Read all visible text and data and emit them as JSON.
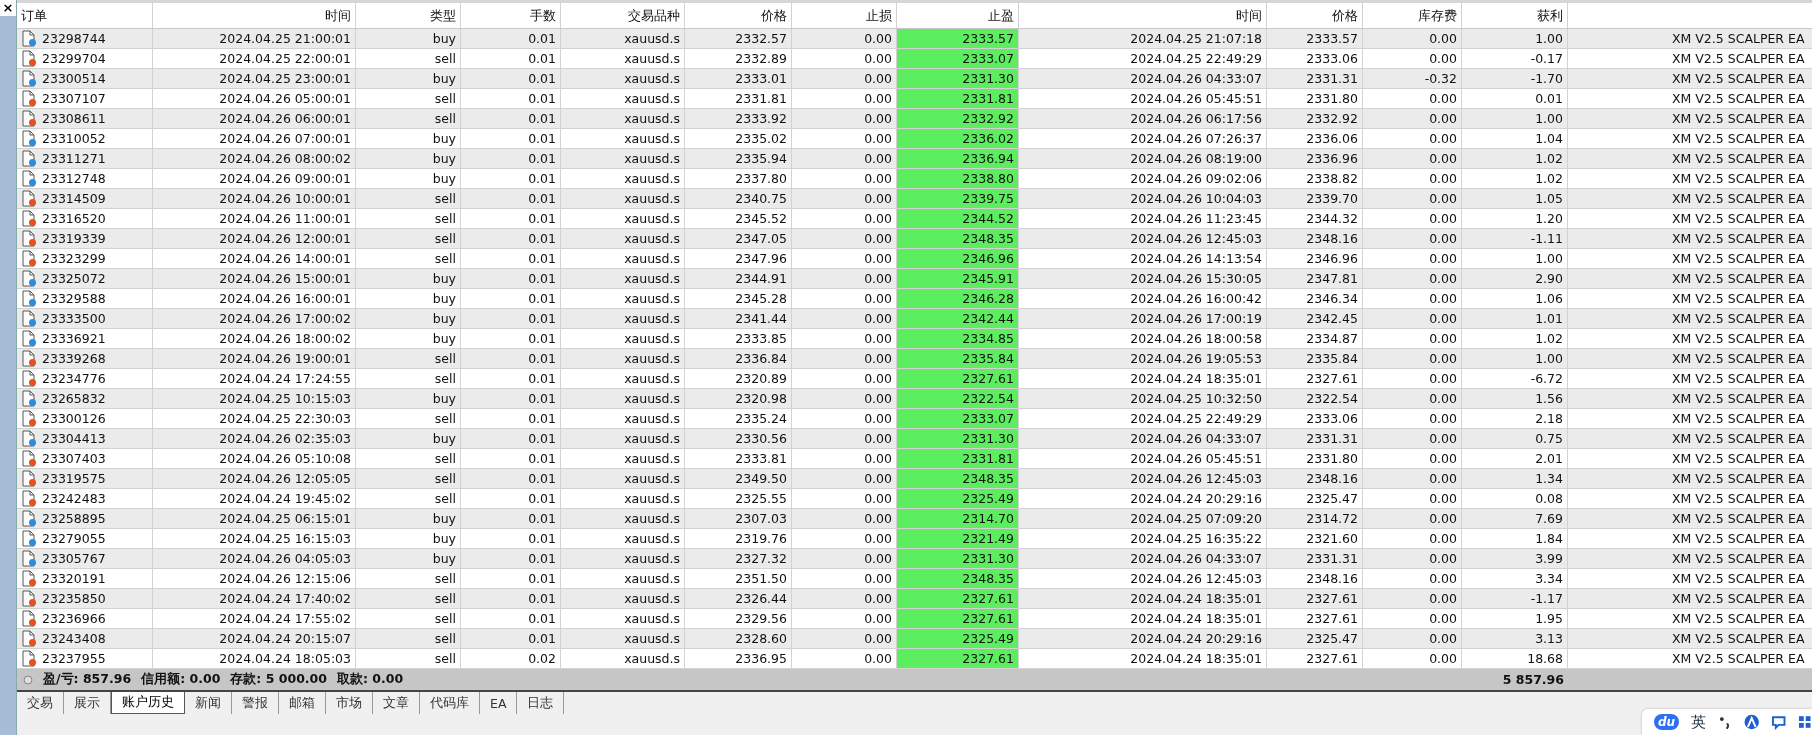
{
  "side_panel": {
    "close_glyph": "×"
  },
  "table": {
    "columns": [
      "订单",
      "时间",
      "类型",
      "手数",
      "交易品种",
      "价格",
      "止损",
      "止盈",
      "时间",
      "价格",
      "库存费",
      "获利"
    ],
    "rows": [
      {
        "color": "#2b8de0",
        "cells": [
          "23298744",
          "2024.04.25 21:00:01",
          "buy",
          "0.01",
          "xauusd.s",
          "2332.57",
          "0.00",
          "2333.57",
          "2024.04.25 21:07:18",
          "2333.57",
          "0.00",
          "1.00",
          "XM V2.5 SCALPER EA"
        ]
      },
      {
        "color": "#e8501e",
        "cells": [
          "23299704",
          "2024.04.25 22:00:01",
          "sell",
          "0.01",
          "xauusd.s",
          "2332.89",
          "0.00",
          "2333.07",
          "2024.04.25 22:49:29",
          "2333.06",
          "0.00",
          "-0.17",
          "XM V2.5 SCALPER EA"
        ]
      },
      {
        "color": "#2b8de0",
        "cells": [
          "23300514",
          "2024.04.25 23:00:01",
          "buy",
          "0.01",
          "xauusd.s",
          "2333.01",
          "0.00",
          "2331.30",
          "2024.04.26 04:33:07",
          "2331.31",
          "-0.32",
          "-1.70",
          "XM V2.5 SCALPER EA"
        ]
      },
      {
        "color": "#e8501e",
        "cells": [
          "23307107",
          "2024.04.26 05:00:01",
          "sell",
          "0.01",
          "xauusd.s",
          "2331.81",
          "0.00",
          "2331.81",
          "2024.04.26 05:45:51",
          "2331.80",
          "0.00",
          "0.01",
          "XM V2.5 SCALPER EA"
        ]
      },
      {
        "color": "#e8501e",
        "cells": [
          "23308611",
          "2024.04.26 06:00:01",
          "sell",
          "0.01",
          "xauusd.s",
          "2333.92",
          "0.00",
          "2332.92",
          "2024.04.26 06:17:56",
          "2332.92",
          "0.00",
          "1.00",
          "XM V2.5 SCALPER EA"
        ]
      },
      {
        "color": "#2b8de0",
        "cells": [
          "23310052",
          "2024.04.26 07:00:01",
          "buy",
          "0.01",
          "xauusd.s",
          "2335.02",
          "0.00",
          "2336.02",
          "2024.04.26 07:26:37",
          "2336.06",
          "0.00",
          "1.04",
          "XM V2.5 SCALPER EA"
        ]
      },
      {
        "color": "#2b8de0",
        "cells": [
          "23311271",
          "2024.04.26 08:00:02",
          "buy",
          "0.01",
          "xauusd.s",
          "2335.94",
          "0.00",
          "2336.94",
          "2024.04.26 08:19:00",
          "2336.96",
          "0.00",
          "1.02",
          "XM V2.5 SCALPER EA"
        ]
      },
      {
        "color": "#2b8de0",
        "cells": [
          "23312748",
          "2024.04.26 09:00:01",
          "buy",
          "0.01",
          "xauusd.s",
          "2337.80",
          "0.00",
          "2338.80",
          "2024.04.26 09:02:06",
          "2338.82",
          "0.00",
          "1.02",
          "XM V2.5 SCALPER EA"
        ]
      },
      {
        "color": "#e8501e",
        "cells": [
          "23314509",
          "2024.04.26 10:00:01",
          "sell",
          "0.01",
          "xauusd.s",
          "2340.75",
          "0.00",
          "2339.75",
          "2024.04.26 10:04:03",
          "2339.70",
          "0.00",
          "1.05",
          "XM V2.5 SCALPER EA"
        ]
      },
      {
        "color": "#e8501e",
        "cells": [
          "23316520",
          "2024.04.26 11:00:01",
          "sell",
          "0.01",
          "xauusd.s",
          "2345.52",
          "0.00",
          "2344.52",
          "2024.04.26 11:23:45",
          "2344.32",
          "0.00",
          "1.20",
          "XM V2.5 SCALPER EA"
        ]
      },
      {
        "color": "#e8501e",
        "cells": [
          "23319339",
          "2024.04.26 12:00:01",
          "sell",
          "0.01",
          "xauusd.s",
          "2347.05",
          "0.00",
          "2348.35",
          "2024.04.26 12:45:03",
          "2348.16",
          "0.00",
          "-1.11",
          "XM V2.5 SCALPER EA"
        ]
      },
      {
        "color": "#e8501e",
        "cells": [
          "23323299",
          "2024.04.26 14:00:01",
          "sell",
          "0.01",
          "xauusd.s",
          "2347.96",
          "0.00",
          "2346.96",
          "2024.04.26 14:13:54",
          "2346.96",
          "0.00",
          "1.00",
          "XM V2.5 SCALPER EA"
        ]
      },
      {
        "color": "#2b8de0",
        "cells": [
          "23325072",
          "2024.04.26 15:00:01",
          "buy",
          "0.01",
          "xauusd.s",
          "2344.91",
          "0.00",
          "2345.91",
          "2024.04.26 15:30:05",
          "2347.81",
          "0.00",
          "2.90",
          "XM V2.5 SCALPER EA"
        ]
      },
      {
        "color": "#2b8de0",
        "cells": [
          "23329588",
          "2024.04.26 16:00:01",
          "buy",
          "0.01",
          "xauusd.s",
          "2345.28",
          "0.00",
          "2346.28",
          "2024.04.26 16:00:42",
          "2346.34",
          "0.00",
          "1.06",
          "XM V2.5 SCALPER EA"
        ]
      },
      {
        "color": "#2b8de0",
        "cells": [
          "23333500",
          "2024.04.26 17:00:02",
          "buy",
          "0.01",
          "xauusd.s",
          "2341.44",
          "0.00",
          "2342.44",
          "2024.04.26 17:00:19",
          "2342.45",
          "0.00",
          "1.01",
          "XM V2.5 SCALPER EA"
        ]
      },
      {
        "color": "#2b8de0",
        "cells": [
          "23336921",
          "2024.04.26 18:00:02",
          "buy",
          "0.01",
          "xauusd.s",
          "2333.85",
          "0.00",
          "2334.85",
          "2024.04.26 18:00:58",
          "2334.87",
          "0.00",
          "1.02",
          "XM V2.5 SCALPER EA"
        ]
      },
      {
        "color": "#e8501e",
        "cells": [
          "23339268",
          "2024.04.26 19:00:01",
          "sell",
          "0.01",
          "xauusd.s",
          "2336.84",
          "0.00",
          "2335.84",
          "2024.04.26 19:05:53",
          "2335.84",
          "0.00",
          "1.00",
          "XM V2.5 SCALPER EA"
        ]
      },
      {
        "color": "#e8501e",
        "cells": [
          "23234776",
          "2024.04.24 17:24:55",
          "sell",
          "0.01",
          "xauusd.s",
          "2320.89",
          "0.00",
          "2327.61",
          "2024.04.24 18:35:01",
          "2327.61",
          "0.00",
          "-6.72",
          "XM V2.5 SCALPER EA"
        ]
      },
      {
        "color": "#2b8de0",
        "cells": [
          "23265832",
          "2024.04.25 10:15:03",
          "buy",
          "0.01",
          "xauusd.s",
          "2320.98",
          "0.00",
          "2322.54",
          "2024.04.25 10:32:50",
          "2322.54",
          "0.00",
          "1.56",
          "XM V2.5 SCALPER EA"
        ]
      },
      {
        "color": "#e8501e",
        "cells": [
          "23300126",
          "2024.04.25 22:30:03",
          "sell",
          "0.01",
          "xauusd.s",
          "2335.24",
          "0.00",
          "2333.07",
          "2024.04.25 22:49:29",
          "2333.06",
          "0.00",
          "2.18",
          "XM V2.5 SCALPER EA"
        ]
      },
      {
        "color": "#2b8de0",
        "cells": [
          "23304413",
          "2024.04.26 02:35:03",
          "buy",
          "0.01",
          "xauusd.s",
          "2330.56",
          "0.00",
          "2331.30",
          "2024.04.26 04:33:07",
          "2331.31",
          "0.00",
          "0.75",
          "XM V2.5 SCALPER EA"
        ]
      },
      {
        "color": "#e8501e",
        "cells": [
          "23307403",
          "2024.04.26 05:10:08",
          "sell",
          "0.01",
          "xauusd.s",
          "2333.81",
          "0.00",
          "2331.81",
          "2024.04.26 05:45:51",
          "2331.80",
          "0.00",
          "2.01",
          "XM V2.5 SCALPER EA"
        ]
      },
      {
        "color": "#e8501e",
        "cells": [
          "23319575",
          "2024.04.26 12:05:05",
          "sell",
          "0.01",
          "xauusd.s",
          "2349.50",
          "0.00",
          "2348.35",
          "2024.04.26 12:45:03",
          "2348.16",
          "0.00",
          "1.34",
          "XM V2.5 SCALPER EA"
        ]
      },
      {
        "color": "#e8501e",
        "cells": [
          "23242483",
          "2024.04.24 19:45:02",
          "sell",
          "0.01",
          "xauusd.s",
          "2325.55",
          "0.00",
          "2325.49",
          "2024.04.24 20:29:16",
          "2325.47",
          "0.00",
          "0.08",
          "XM V2.5 SCALPER EA"
        ]
      },
      {
        "color": "#2b8de0",
        "cells": [
          "23258895",
          "2024.04.25 06:15:01",
          "buy",
          "0.01",
          "xauusd.s",
          "2307.03",
          "0.00",
          "2314.70",
          "2024.04.25 07:09:20",
          "2314.72",
          "0.00",
          "7.69",
          "XM V2.5 SCALPER EA"
        ]
      },
      {
        "color": "#2b8de0",
        "cells": [
          "23279055",
          "2024.04.25 16:15:03",
          "buy",
          "0.01",
          "xauusd.s",
          "2319.76",
          "0.00",
          "2321.49",
          "2024.04.25 16:35:22",
          "2321.60",
          "0.00",
          "1.84",
          "XM V2.5 SCALPER EA"
        ]
      },
      {
        "color": "#2b8de0",
        "cells": [
          "23305767",
          "2024.04.26 04:05:03",
          "buy",
          "0.01",
          "xauusd.s",
          "2327.32",
          "0.00",
          "2331.30",
          "2024.04.26 04:33:07",
          "2331.31",
          "0.00",
          "3.99",
          "XM V2.5 SCALPER EA"
        ]
      },
      {
        "color": "#e8501e",
        "cells": [
          "23320191",
          "2024.04.26 12:15:06",
          "sell",
          "0.01",
          "xauusd.s",
          "2351.50",
          "0.00",
          "2348.35",
          "2024.04.26 12:45:03",
          "2348.16",
          "0.00",
          "3.34",
          "XM V2.5 SCALPER EA"
        ]
      },
      {
        "color": "#e8501e",
        "cells": [
          "23235850",
          "2024.04.24 17:40:02",
          "sell",
          "0.01",
          "xauusd.s",
          "2326.44",
          "0.00",
          "2327.61",
          "2024.04.24 18:35:01",
          "2327.61",
          "0.00",
          "-1.17",
          "XM V2.5 SCALPER EA"
        ]
      },
      {
        "color": "#e8501e",
        "cells": [
          "23236966",
          "2024.04.24 17:55:02",
          "sell",
          "0.01",
          "xauusd.s",
          "2329.56",
          "0.00",
          "2327.61",
          "2024.04.24 18:35:01",
          "2327.61",
          "0.00",
          "1.95",
          "XM V2.5 SCALPER EA"
        ]
      },
      {
        "color": "#e8501e",
        "cells": [
          "23243408",
          "2024.04.24 20:15:07",
          "sell",
          "0.01",
          "xauusd.s",
          "2328.60",
          "0.00",
          "2325.49",
          "2024.04.24 20:29:16",
          "2325.47",
          "0.00",
          "3.13",
          "XM V2.5 SCALPER EA"
        ]
      },
      {
        "color": "#e8501e",
        "cells": [
          "23237955",
          "2024.04.24 18:05:03",
          "sell",
          "0.02",
          "xauusd.s",
          "2336.95",
          "0.00",
          "2327.61",
          "2024.04.24 18:35:01",
          "2327.61",
          "0.00",
          "18.68",
          "XM V2.5 SCALPER EA"
        ]
      }
    ]
  },
  "summary": {
    "items": [
      "盈/亏: 857.96",
      "信用额: 0.00",
      "存款: 5 000.00",
      "取款: 0.00"
    ],
    "total": "5 857.96"
  },
  "tabs": [
    {
      "label": "交易",
      "selected": false
    },
    {
      "label": "展示",
      "selected": false
    },
    {
      "label": "账户历史",
      "selected": true
    },
    {
      "label": "新闻",
      "selected": false
    },
    {
      "label": "警报",
      "selected": false
    },
    {
      "label": "邮箱",
      "selected": false
    },
    {
      "label": "市场",
      "selected": false
    },
    {
      "label": "文章",
      "selected": false
    },
    {
      "label": "代码库",
      "selected": false
    },
    {
      "label": "EA",
      "selected": false
    },
    {
      "label": "日志",
      "selected": false
    }
  ],
  "ime_toolbar": {
    "logo": "du",
    "language": "英"
  }
}
